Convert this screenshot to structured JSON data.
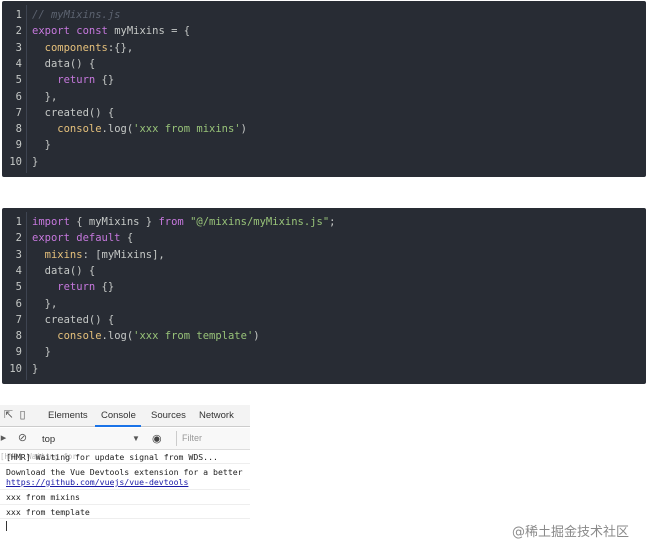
{
  "code_block_1": {
    "lines": [
      {
        "n": "1",
        "parts": [
          {
            "t": "// myMixins.js",
            "c": "c-comment"
          }
        ]
      },
      {
        "n": "2",
        "parts": [
          {
            "t": "export const ",
            "c": "c-kw"
          },
          {
            "t": "myMixins = {",
            "c": "c-plain"
          }
        ]
      },
      {
        "n": "3",
        "parts": [
          {
            "t": "  components",
            "c": "c-prop"
          },
          {
            "t": ":{},",
            "c": "c-plain"
          }
        ]
      },
      {
        "n": "4",
        "parts": [
          {
            "t": "  data() {",
            "c": "c-plain"
          }
        ]
      },
      {
        "n": "5",
        "parts": [
          {
            "t": "    return ",
            "c": "c-kw"
          },
          {
            "t": "{}",
            "c": "c-plain"
          }
        ]
      },
      {
        "n": "6",
        "parts": [
          {
            "t": "  },",
            "c": "c-plain"
          }
        ]
      },
      {
        "n": "7",
        "parts": [
          {
            "t": "  created() {",
            "c": "c-plain"
          }
        ]
      },
      {
        "n": "8",
        "parts": [
          {
            "t": "    console",
            "c": "c-prop"
          },
          {
            "t": ".log(",
            "c": "c-plain"
          },
          {
            "t": "'xxx from mixins'",
            "c": "c-str"
          },
          {
            "t": ")",
            "c": "c-plain"
          }
        ]
      },
      {
        "n": "9",
        "parts": [
          {
            "t": "  }",
            "c": "c-plain"
          }
        ]
      },
      {
        "n": "10",
        "parts": [
          {
            "t": "}",
            "c": "c-plain"
          }
        ]
      }
    ]
  },
  "code_block_2": {
    "lines": [
      {
        "n": "1",
        "parts": [
          {
            "t": "import ",
            "c": "c-kw"
          },
          {
            "t": "{ myMixins } ",
            "c": "c-plain"
          },
          {
            "t": "from ",
            "c": "c-kw"
          },
          {
            "t": "\"@/mixins/myMixins.js\"",
            "c": "c-str"
          },
          {
            "t": ";",
            "c": "c-plain"
          }
        ]
      },
      {
        "n": "2",
        "parts": [
          {
            "t": "export default ",
            "c": "c-kw"
          },
          {
            "t": "{",
            "c": "c-plain"
          }
        ]
      },
      {
        "n": "3",
        "parts": [
          {
            "t": "  mixins",
            "c": "c-prop"
          },
          {
            "t": ": [myMixins],",
            "c": "c-plain"
          }
        ]
      },
      {
        "n": "4",
        "parts": [
          {
            "t": "  data() {",
            "c": "c-plain"
          }
        ]
      },
      {
        "n": "5",
        "parts": [
          {
            "t": "    return ",
            "c": "c-kw"
          },
          {
            "t": "{}",
            "c": "c-plain"
          }
        ]
      },
      {
        "n": "6",
        "parts": [
          {
            "t": "  },",
            "c": "c-plain"
          }
        ]
      },
      {
        "n": "7",
        "parts": [
          {
            "t": "  created() {",
            "c": "c-plain"
          }
        ]
      },
      {
        "n": "8",
        "parts": [
          {
            "t": "    console",
            "c": "c-prop"
          },
          {
            "t": ".log(",
            "c": "c-plain"
          },
          {
            "t": "'xxx from template'",
            "c": "c-str"
          },
          {
            "t": ")",
            "c": "c-plain"
          }
        ]
      },
      {
        "n": "9",
        "parts": [
          {
            "t": "  }",
            "c": "c-plain"
          }
        ]
      },
      {
        "n": "10",
        "parts": [
          {
            "t": "}",
            "c": "c-plain"
          }
        ]
      }
    ]
  },
  "colors": {
    "editor_bg": "#282c34",
    "keyword": "#c678dd",
    "property": "#e5c07b",
    "string": "#98c379",
    "comment": "#5c6370",
    "devtools_active_tab": "#1a73e8"
  },
  "devtools": {
    "tabs": [
      "Elements",
      "Console",
      "Sources",
      "Network"
    ],
    "active_tab": "Console",
    "context": "top",
    "filter_placeholder": "Filter",
    "ghost_text": "[HMR] Waiting for",
    "logs": {
      "hmr": "[HMR] Waiting for update signal from WDS...",
      "devtools_line1": "Download the Vue Devtools extension for a better",
      "devtools_link": "https://github.com/vuejs/vue-devtools",
      "mixins": "xxx from mixins",
      "template": "xxx from template"
    },
    "icons": [
      "inspect-icon",
      "device-toggle-icon",
      "sidebar-toggle-icon",
      "clear-console-icon",
      "eye-icon",
      "caret-down-icon"
    ]
  },
  "watermark": "@稀土掘金技术社区"
}
